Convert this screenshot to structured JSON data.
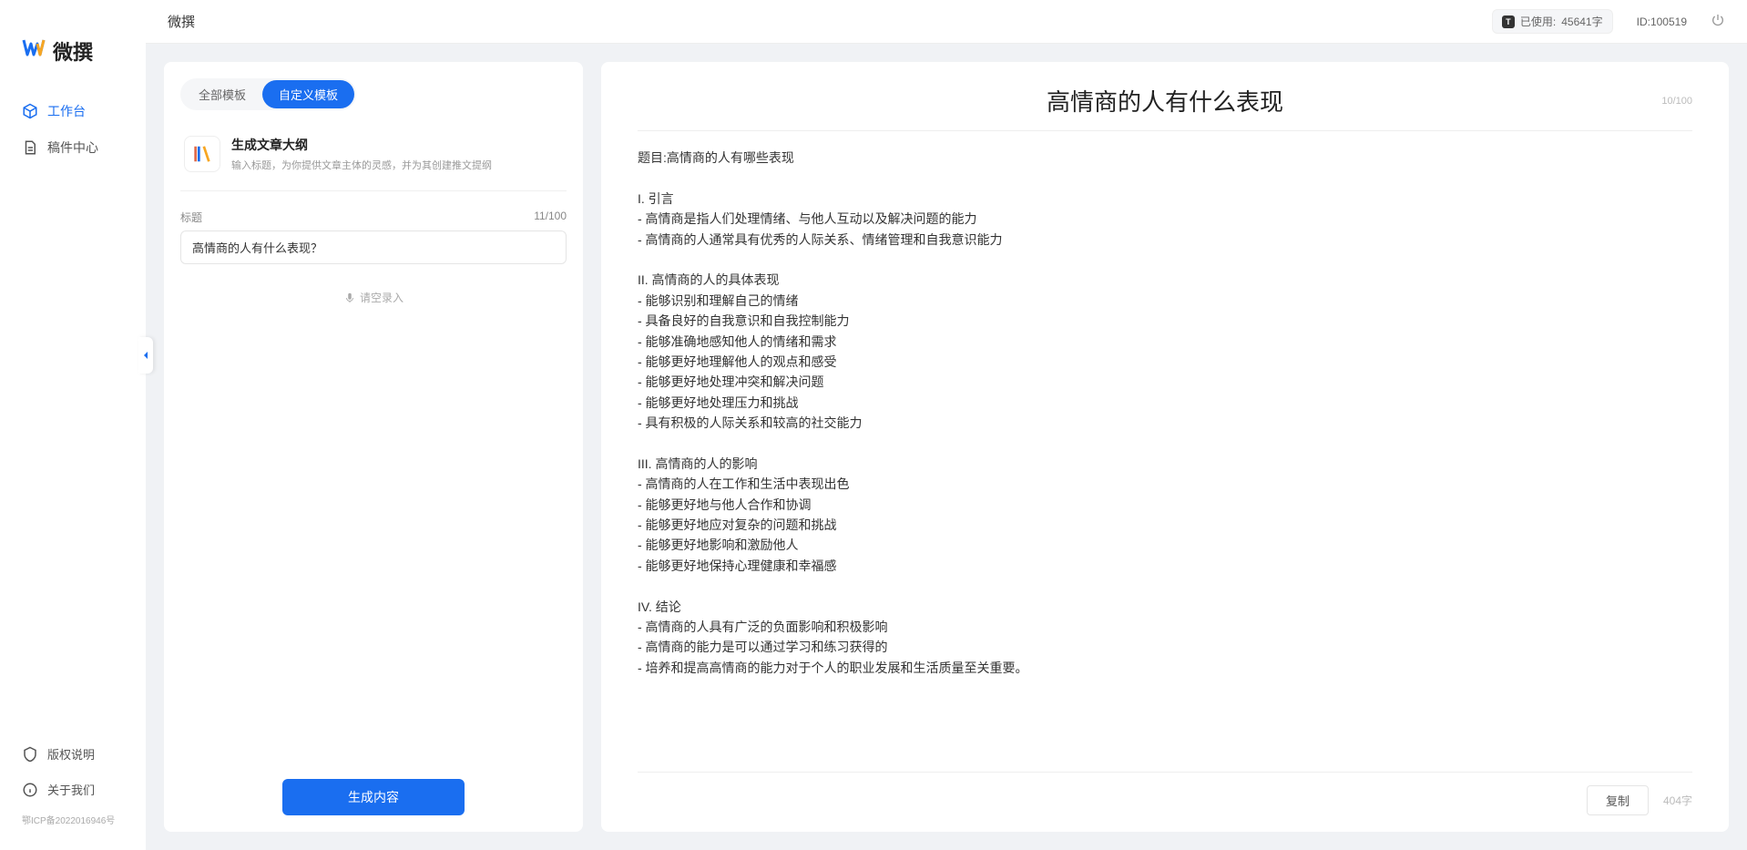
{
  "app": {
    "name": "微撰",
    "logo_letter": "W"
  },
  "sidebar": {
    "nav": [
      {
        "key": "workspace",
        "label": "工作台",
        "active": true
      },
      {
        "key": "drafts",
        "label": "稿件中心",
        "active": false
      }
    ],
    "bottom": [
      {
        "key": "copyright",
        "label": "版权说明"
      },
      {
        "key": "about",
        "label": "关于我们"
      }
    ],
    "icp": "鄂ICP备2022016946号"
  },
  "topbar": {
    "title": "微撰",
    "usage_prefix": "已使用:",
    "usage_value": "45641字",
    "user_id_label": "ID:100519"
  },
  "left": {
    "tabs": [
      {
        "key": "all",
        "label": "全部模板",
        "active": false
      },
      {
        "key": "custom",
        "label": "自定义模板",
        "active": true
      }
    ],
    "template": {
      "title": "生成文章大纲",
      "desc": "输入标题，为你提供文章主体的灵感，并为其创建推文提纲"
    },
    "title_field": {
      "label": "标题",
      "counter": "11/100",
      "value": "高情商的人有什么表现？"
    },
    "voice_hint": "请空录入",
    "generate_label": "生成内容"
  },
  "right": {
    "title": "高情商的人有什么表现",
    "title_counter": "10/100",
    "body": "题目:高情商的人有哪些表现\n\nI. 引言\n- 高情商是指人们处理情绪、与他人互动以及解决问题的能力\n- 高情商的人通常具有优秀的人际关系、情绪管理和自我意识能力\n\nII. 高情商的人的具体表现\n- 能够识别和理解自己的情绪\n- 具备良好的自我意识和自我控制能力\n- 能够准确地感知他人的情绪和需求\n- 能够更好地理解他人的观点和感受\n- 能够更好地处理冲突和解决问题\n- 能够更好地处理压力和挑战\n- 具有积极的人际关系和较高的社交能力\n\nIII. 高情商的人的影响\n- 高情商的人在工作和生活中表现出色\n- 能够更好地与他人合作和协调\n- 能够更好地应对复杂的问题和挑战\n- 能够更好地影响和激励他人\n- 能够更好地保持心理健康和幸福感\n\nIV. 结论\n- 高情商的人具有广泛的负面影响和积极影响\n- 高情商的能力是可以通过学习和练习获得的\n- 培养和提高高情商的能力对于个人的职业发展和生活质量至关重要。",
    "copy_label": "复制",
    "char_count": "404字"
  }
}
